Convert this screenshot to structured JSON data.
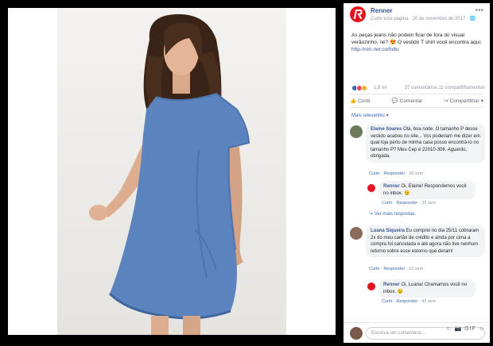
{
  "page": {
    "name": "Renner",
    "meta": "Curtir esta página · 20 de novembro de 2017 · 🌐",
    "post_text": "As peças jeans não podem ficar de fora do visual verãozinho, né? 😍 O vestido T shirt você encontra aqui: ",
    "post_link": "http://ren.ner.co/fn8u",
    "reaction_count": "1,8 mi",
    "comments_count": "37 comentários",
    "shares_count": "11 compartilhamentos",
    "colors": {
      "brand": "#e3161f",
      "link": "#385898"
    }
  },
  "actions": {
    "like": "Curtir",
    "comment": "Comentar",
    "share": "Compartilhar"
  },
  "sort_label": "Mais relevantes ▾",
  "comments": [
    {
      "name": "Elaine Soares",
      "text": "Olá, boa noite. O tamanho P desse vestido acabou no site... Vcs poderiam me dizer em qual loja perto de minha casa posso encontrá-lo no tamanho P? Meu Cep é 22010-306. Aguardo, obrigada.",
      "like": "Curtir",
      "reply": "Responder",
      "time": "39 sem"
    },
    {
      "name": "Renner",
      "text": "Oi, Elaine! Respondemos você no inbox. 😉",
      "like": "Curtir",
      "reply": "Responder",
      "time": "32 sem"
    },
    {
      "more_replies": "↪ Ver mais respostas"
    },
    {
      "name": "Luana Siqueira",
      "text": "Eu comprei no dia 25/11 cobraram 2x do meu cartão de crédito e ainda por cima a compra foi cancelada e até agora não tive nenhum retorno sobre esse estorno que deram!",
      "like": "Curtir",
      "reply": "Responder",
      "time": "10 sem"
    },
    {
      "name": "Renner",
      "text": "Oi, Luana! Chamamos você no inbox. 😉",
      "like": "Curtir",
      "reply": "Responder",
      "time": "43 sem"
    }
  ],
  "write": {
    "placeholder": "Escreva um comentário...",
    "icons": "☺ 📷 GIF ☺"
  }
}
